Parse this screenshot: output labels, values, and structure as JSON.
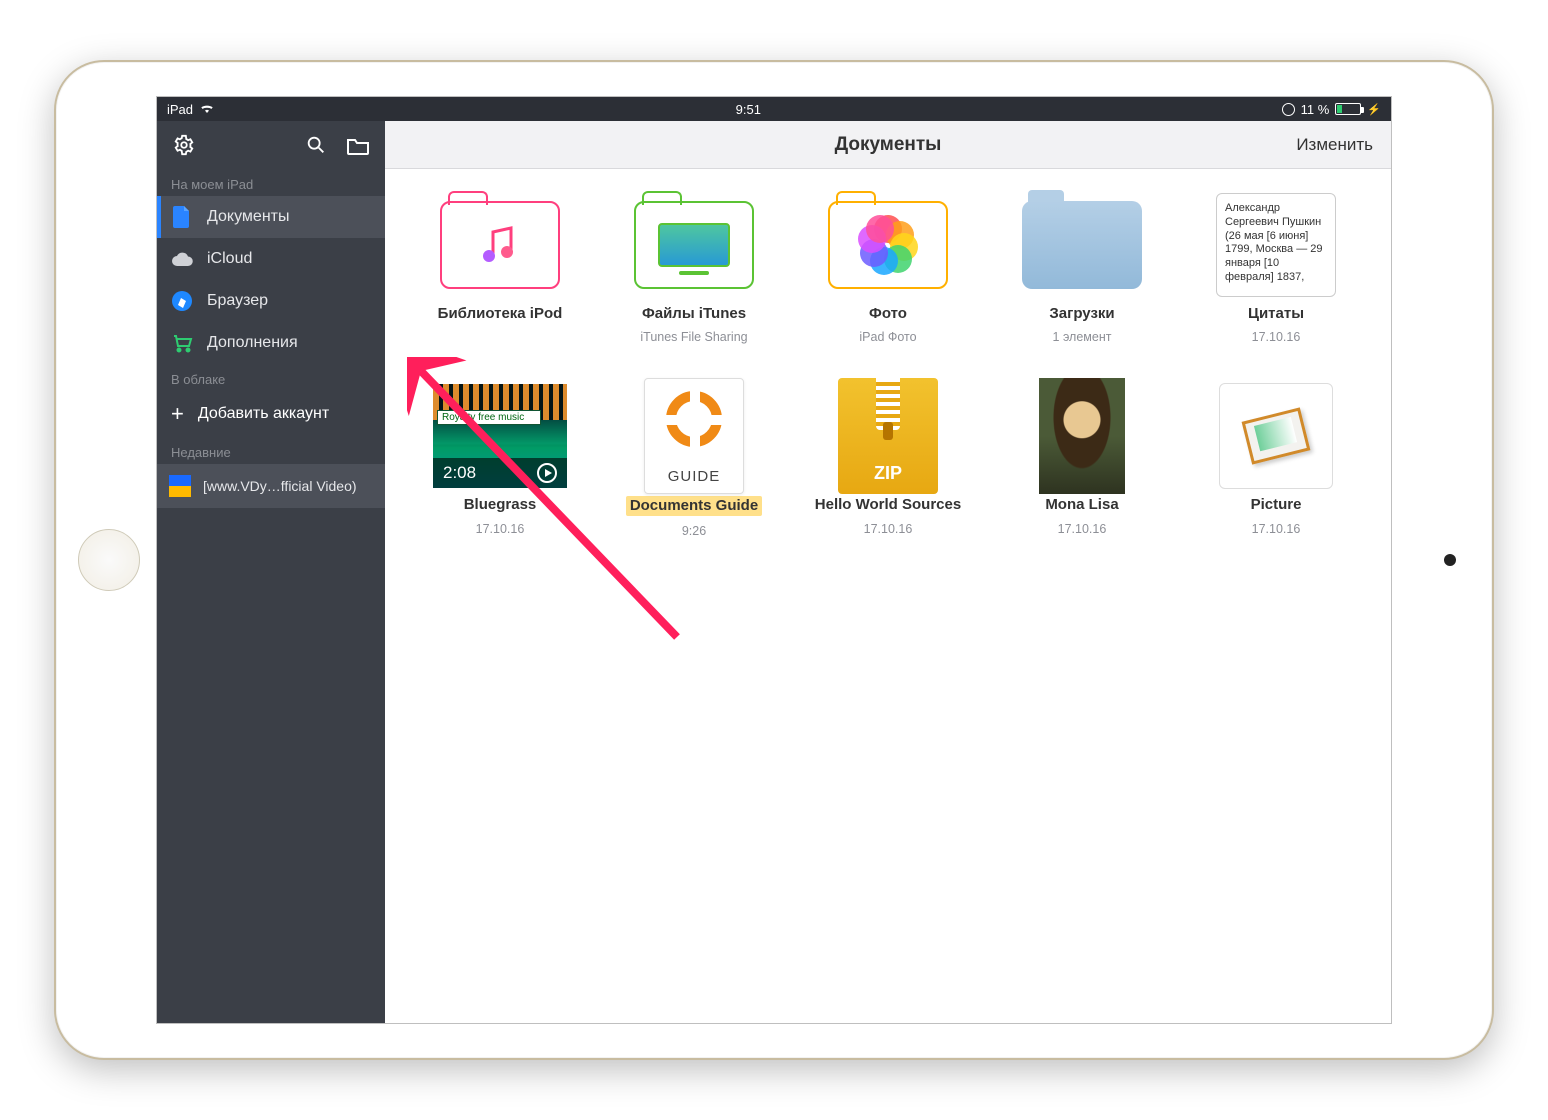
{
  "status": {
    "device": "iPad",
    "time": "9:51",
    "battery_pct": "11 %"
  },
  "sidebar": {
    "section_my": "На моем iPad",
    "items": [
      {
        "label": "Документы"
      },
      {
        "label": "iCloud"
      },
      {
        "label": "Браузер"
      },
      {
        "label": "Дополнения"
      }
    ],
    "section_cloud": "В облаке",
    "add_account": "Добавить аккаунт",
    "section_recent": "Недавние",
    "recent_item": "[www.VDy…fficial Video)"
  },
  "main": {
    "title": "Документы",
    "edit": "Изменить",
    "tiles": [
      {
        "title": "Библиотека iPod",
        "sub": ""
      },
      {
        "title": "Файлы iTunes",
        "sub": "iTunes File Sharing"
      },
      {
        "title": "Фото",
        "sub": "iPad Фото"
      },
      {
        "title": "Загрузки",
        "sub": "1 элемент"
      },
      {
        "title": "Цитаты",
        "sub": "17.10.16",
        "doc_text": "Александр Сергеевич Пушкин (26 мая [6 июня] 1799, Москва — 29 января [10 февраля] 1837,"
      },
      {
        "title": "Bluegrass",
        "sub": "17.10.16",
        "duration": "2:08",
        "strip": "Royalty free music"
      },
      {
        "title": "Documents Guide",
        "sub": "9:26",
        "guide_label": "GUIDE"
      },
      {
        "title": "Hello World Sources",
        "sub": "17.10.16",
        "zip_label": "ZIP"
      },
      {
        "title": "Mona Lisa",
        "sub": "17.10.16"
      },
      {
        "title": "Picture",
        "sub": "17.10.16"
      }
    ]
  }
}
